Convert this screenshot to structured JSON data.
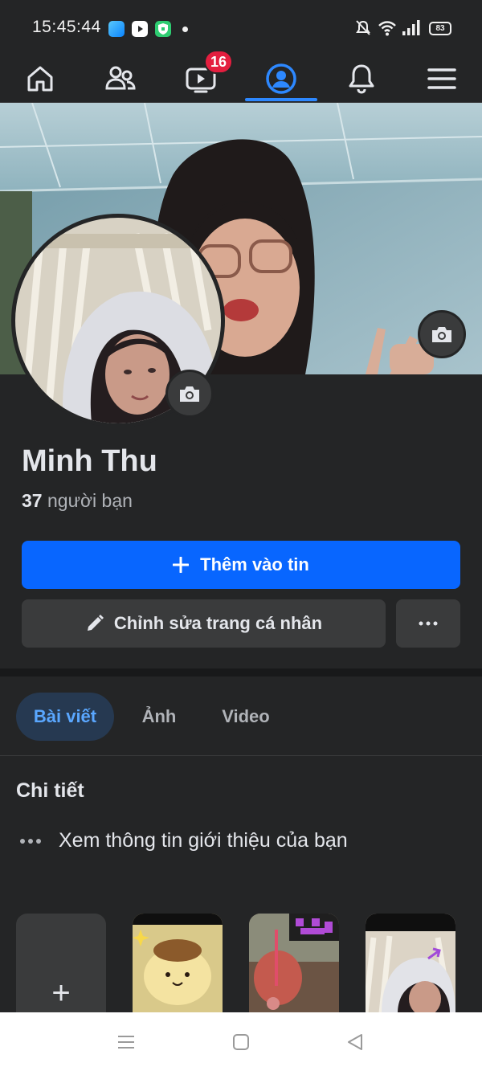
{
  "status_bar": {
    "time": "15:45:44",
    "battery": "83",
    "app_icons": [
      "messenger-icon",
      "youtube-icon",
      "shield-vpn-icon"
    ],
    "right_icons": [
      "mute-bell-icon",
      "wifi-icon",
      "signal-icon",
      "battery-icon"
    ]
  },
  "nav": {
    "items": [
      "home-icon",
      "friends-icon",
      "watch-icon",
      "profile-icon",
      "notifications-icon",
      "menu-icon"
    ],
    "watch_badge": "16",
    "active": "profile"
  },
  "profile": {
    "name": "Minh Thu",
    "friends_count": "37",
    "friends_label": "người bạn"
  },
  "actions": {
    "add_story_label": "Thêm vào tin",
    "edit_profile_label": "Chỉnh sửa trang cá nhân",
    "more_label": "···"
  },
  "tabs": [
    {
      "label": "Bài viết",
      "active": true
    },
    {
      "label": "Ảnh",
      "active": false
    },
    {
      "label": "Video",
      "active": false
    }
  ],
  "details": {
    "title": "Chi tiết",
    "intro_text": "Xem thông tin giới thiệu của bạn"
  },
  "stories": {
    "add_label": "+",
    "items": [
      "story-photo-1",
      "story-photo-2",
      "story-photo-3"
    ]
  },
  "colors": {
    "background": "#242526",
    "accent": "#0866ff",
    "active_tab_bg": "#263951",
    "active_tab_text": "#5aa7ff",
    "badge": "#e41e3f",
    "secondary_button": "#3a3b3c"
  }
}
